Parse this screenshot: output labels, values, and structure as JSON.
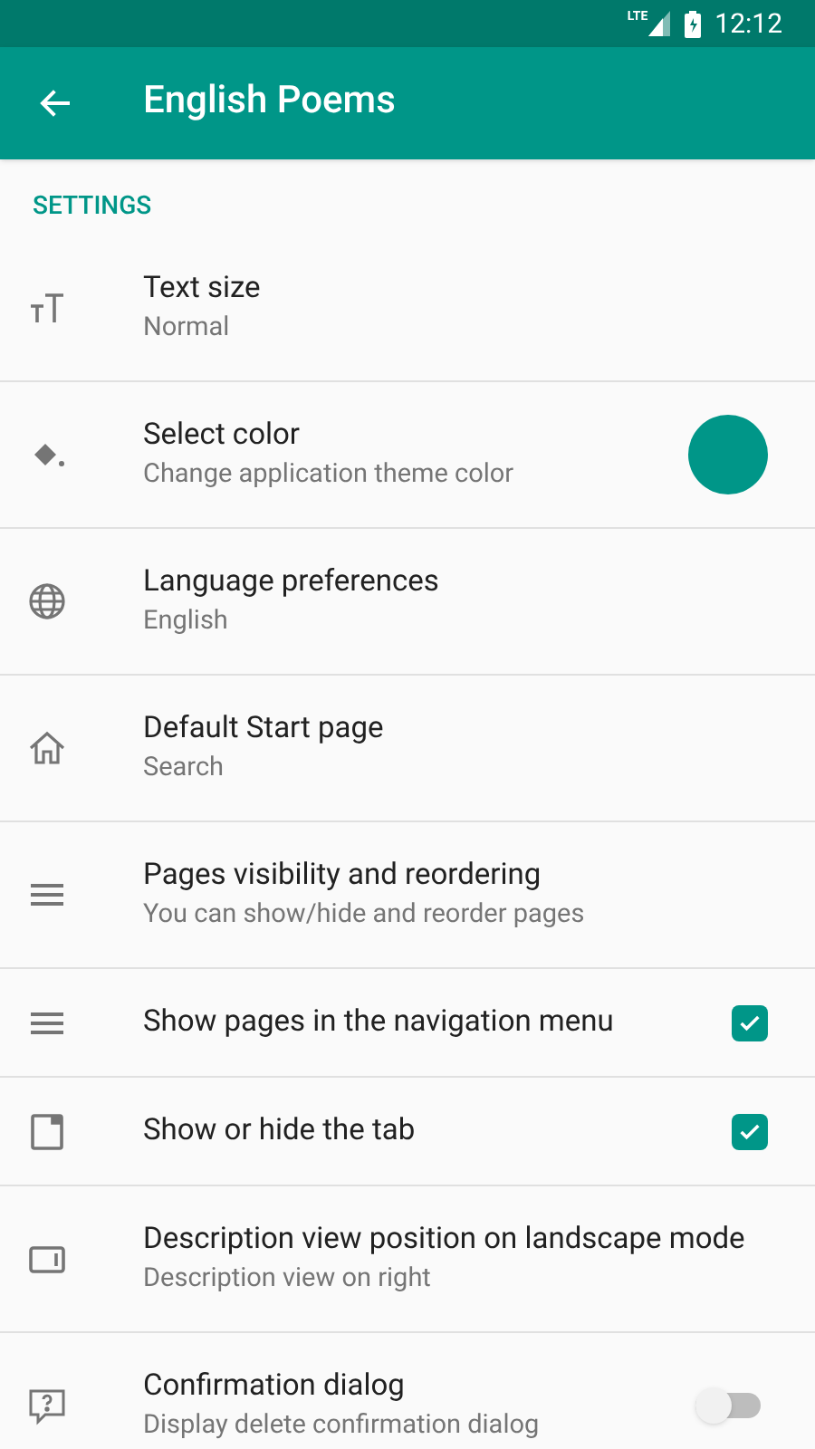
{
  "status_bar": {
    "network": "LTE",
    "time": "12:12"
  },
  "app_bar": {
    "title": "English Poems"
  },
  "section": "SETTINGS",
  "items": [
    {
      "kind": "plain",
      "title": "Text size",
      "subtitle": "Normal"
    },
    {
      "kind": "color",
      "title": "Select color",
      "subtitle": "Change application theme color",
      "color": "#009688"
    },
    {
      "kind": "plain",
      "title": "Language preferences",
      "subtitle": "English"
    },
    {
      "kind": "plain",
      "title": "Default Start page",
      "subtitle": "Search"
    },
    {
      "kind": "plain",
      "title": "Pages visibility and reordering",
      "subtitle": "You can show/hide and reorder pages"
    },
    {
      "kind": "checkbox",
      "title": "Show pages in the navigation menu",
      "checked": true
    },
    {
      "kind": "checkbox",
      "title": "Show or hide the tab",
      "checked": true
    },
    {
      "kind": "plain",
      "title": "Description view position on landscape mode",
      "subtitle": "Description view on right"
    },
    {
      "kind": "switch",
      "title": "Confirmation dialog",
      "subtitle": "Display delete confirmation dialog",
      "on": false
    }
  ]
}
